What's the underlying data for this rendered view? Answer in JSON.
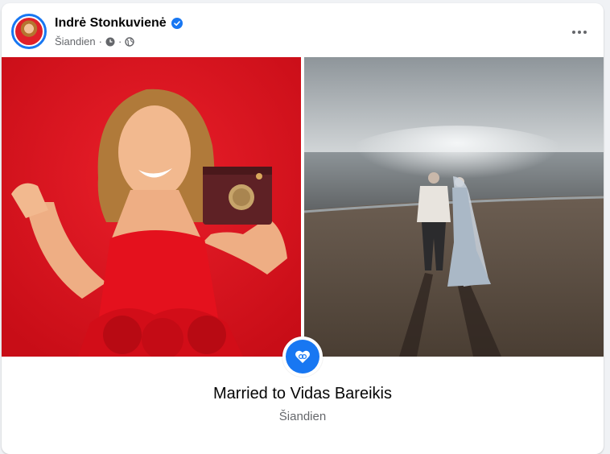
{
  "post": {
    "author_name": "Indrė Stonkuvienė",
    "timestamp": "Šiandien",
    "separator": "·",
    "privacy_icon": "globe-icon",
    "activity_icon": "clock-icon",
    "more_icon": "more-horizontal-icon",
    "verified_icon": "verified-badge-icon"
  },
  "life_event": {
    "title": "Married to Vidas Bareikis",
    "date": "Šiandien",
    "icon": "heart-rings-icon"
  },
  "colors": {
    "accent": "#1877f2",
    "text_primary": "#050505",
    "text_secondary": "#65676b",
    "photo_left_bg": "#d7141c"
  }
}
